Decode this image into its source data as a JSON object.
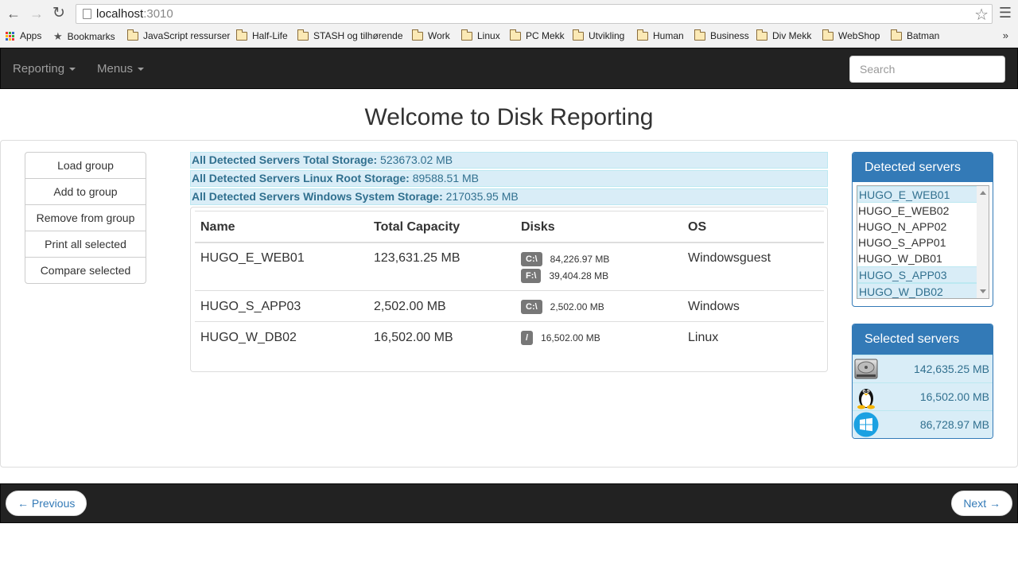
{
  "browser": {
    "url_host": "localhost",
    "url_port": ":3010",
    "bookmarks": [
      "Apps",
      "Bookmarks",
      "JavaScript ressurser",
      "Half-Life",
      "STASH og tilhørende",
      "Work",
      "Linux",
      "PC Mekk",
      "Utvikling",
      "Human",
      "Business",
      "Div Mekk",
      "WebShop",
      "Batman"
    ],
    "more": "»"
  },
  "navbar": {
    "reporting": "Reporting",
    "menus": "Menus",
    "search_placeholder": "Search"
  },
  "page_title": "Welcome to Disk Reporting",
  "actions": [
    "Load group",
    "Add to group",
    "Remove from group",
    "Print all selected",
    "Compare selected"
  ],
  "summary": [
    {
      "label": "All Detected Servers Total Storage:",
      "value": "523673.02 MB"
    },
    {
      "label": "All Detected Servers Linux Root Storage:",
      "value": "89588.51 MB"
    },
    {
      "label": "All Detected Servers Windows System Storage:",
      "value": "217035.95 MB"
    }
  ],
  "table": {
    "headers": [
      "Name",
      "Total Capacity",
      "Disks",
      "OS"
    ],
    "rows": [
      {
        "name": "HUGO_E_WEB01",
        "capacity": "123,631.25 MB",
        "disks": [
          {
            "label": "C:\\",
            "size": "84,226.97 MB"
          },
          {
            "label": "F:\\",
            "size": "39,404.28 MB"
          }
        ],
        "os": "Windowsguest"
      },
      {
        "name": "HUGO_S_APP03",
        "capacity": "2,502.00 MB",
        "disks": [
          {
            "label": "C:\\",
            "size": "2,502.00 MB"
          }
        ],
        "os": "Windows"
      },
      {
        "name": "HUGO_W_DB02",
        "capacity": "16,502.00 MB",
        "disks": [
          {
            "label": "/",
            "size": "16,502.00 MB"
          }
        ],
        "os": "Linux"
      }
    ]
  },
  "detected": {
    "title": "Detected servers",
    "items": [
      "HUGO_E_WEB01",
      "HUGO_E_WEB02",
      "HUGO_N_APP02",
      "HUGO_S_APP01",
      "HUGO_W_DB01",
      "HUGO_S_APP03",
      "HUGO_W_DB02"
    ],
    "selected": [
      true,
      false,
      false,
      false,
      false,
      true,
      true
    ]
  },
  "selected_servers": {
    "title": "Selected servers",
    "rows": [
      {
        "icon": "hard-drive-icon",
        "value": "142,635.25 MB"
      },
      {
        "icon": "linux-tux-icon",
        "value": "16,502.00 MB"
      },
      {
        "icon": "windows-logo-icon",
        "value": "86,728.97 MB"
      }
    ]
  },
  "footer": {
    "previous": "← Previous",
    "next": "Next →"
  }
}
